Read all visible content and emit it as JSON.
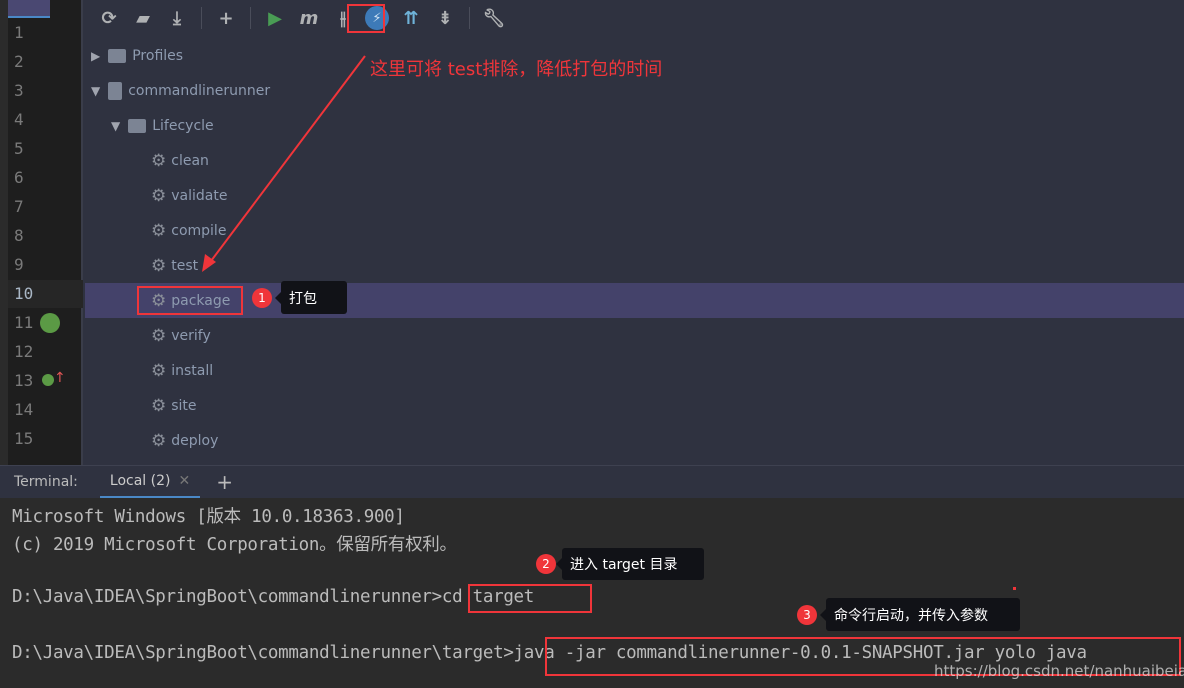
{
  "gutter": {
    "line_numbers": [
      "1",
      "2",
      "3",
      "4",
      "5",
      "6",
      "7",
      "8",
      "9",
      "10",
      "11",
      "12",
      "13",
      "14",
      "15"
    ],
    "current_line": "10"
  },
  "toolbar": {
    "icons": [
      "refresh-icon",
      "reimport-folder-icon",
      "download-icon",
      "add-icon",
      "run-icon",
      "maven-goal-icon",
      "toggle-offline-icon",
      "skip-tests-icon",
      "show-dependencies-icon",
      "collapse-all-icon",
      "settings-wrench-icon"
    ]
  },
  "tree": {
    "profiles": "Profiles",
    "project": "commandlinerunner",
    "lifecycle": "Lifecycle",
    "phases": [
      "clean",
      "validate",
      "compile",
      "test",
      "package",
      "verify",
      "install",
      "site",
      "deploy"
    ],
    "selected": "package"
  },
  "annotations": {
    "skip_test_note": "这里可将 test排除，降低打包的时间",
    "step1_num": "1",
    "step1": "打包",
    "step2_num": "2",
    "step2": "进入 target 目录",
    "step3_num": "3",
    "step3": "命令行启动，并传入参数",
    "accent": "#f0353a"
  },
  "terminal": {
    "label": "Terminal:",
    "tab": "Local (2)",
    "lines": [
      "Microsoft Windows [版本 10.0.18363.900]",
      "(c) 2019 Microsoft Corporation。保留所有权利。",
      "",
      "D:\\Java\\IDEA\\SpringBoot\\commandlinerunner>cd target",
      "",
      "D:\\Java\\IDEA\\SpringBoot\\commandlinerunner\\target>java -jar commandlinerunner-0.0.1-SNAPSHOT.jar yolo java"
    ]
  },
  "watermark": "https://blog.csdn.net/nanhuaibeian"
}
